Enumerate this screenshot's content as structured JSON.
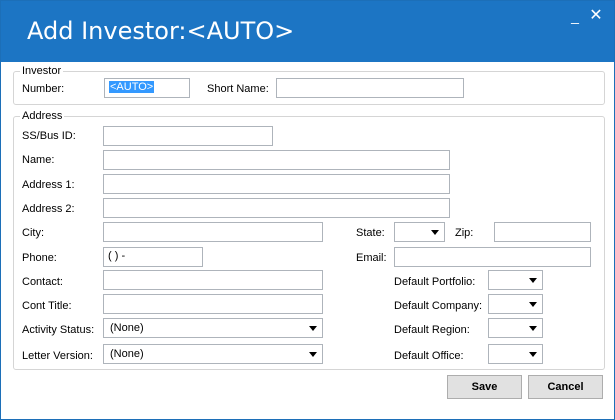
{
  "window": {
    "title": "Add Investor:<AUTO>",
    "min_glyph": "_",
    "close_glyph": "✕"
  },
  "investor": {
    "legend": "Investor",
    "number_label": "Number:",
    "number_value": "<AUTO>",
    "short_name_label": "Short Name:",
    "short_name_value": ""
  },
  "address": {
    "legend": "Address",
    "ss_label": "SS/Bus ID:",
    "name_label": "Name:",
    "address1_label": "Address 1:",
    "address2_label": "Address 2:",
    "city_label": "City:",
    "state_label": "State:",
    "zip_label": "Zip:",
    "phone_label": "Phone:",
    "phone_value": "(  )  -",
    "email_label": "Email:",
    "contact_label": "Contact:",
    "cont_title_label": "Cont Title:",
    "activity_status_label": "Activity Status:",
    "activity_status_value": "(None)",
    "letter_version_label": "Letter Version:",
    "letter_version_value": "(None)",
    "default_portfolio_label": "Default Portfolio:",
    "default_company_label": "Default Company:",
    "default_region_label": "Default Region:",
    "default_office_label": "Default Office:"
  },
  "buttons": {
    "save": "Save",
    "cancel": "Cancel"
  }
}
